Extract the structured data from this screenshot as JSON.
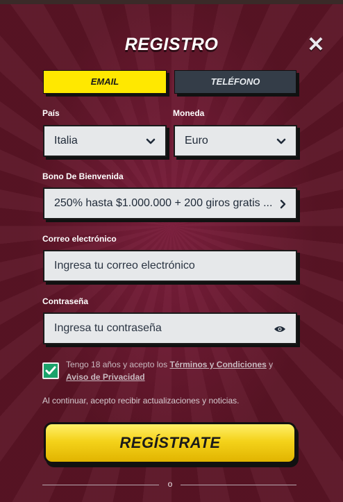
{
  "form": {
    "title": "REGISTRO",
    "close_icon": "close-icon"
  },
  "tabs": [
    {
      "label": "EMAIL",
      "active": true
    },
    {
      "label": "TELÉFONO",
      "active": false
    }
  ],
  "fields": {
    "country": {
      "label": "País",
      "value": "Italia"
    },
    "currency": {
      "label": "Moneda",
      "value": "Euro"
    },
    "bonus": {
      "label": "Bono De Bienvenida",
      "value": "250% hasta $1.000.000 + 200 giros gratis ..."
    },
    "email": {
      "label": "Correo electrónico",
      "placeholder": "Ingresa tu correo electrónico"
    },
    "password": {
      "label": "Contraseña",
      "placeholder": "Ingresa tu contraseña"
    }
  },
  "terms": {
    "checked": true,
    "prefix": "Tengo 18 años y acepto los",
    "terms_link": "Términos y Condiciones",
    "connector": "y",
    "privacy_link": "Aviso de Privacidad"
  },
  "notice": "Al continuar, acepto recibir actualizaciones y noticias.",
  "submit_label": "REGÍSTRATE",
  "divider_text": "o",
  "colors": {
    "background": "#5a1425",
    "accent_yellow": "#ffe800",
    "tab_inactive": "#343d48",
    "checkbox_green": "#1aa36b"
  }
}
